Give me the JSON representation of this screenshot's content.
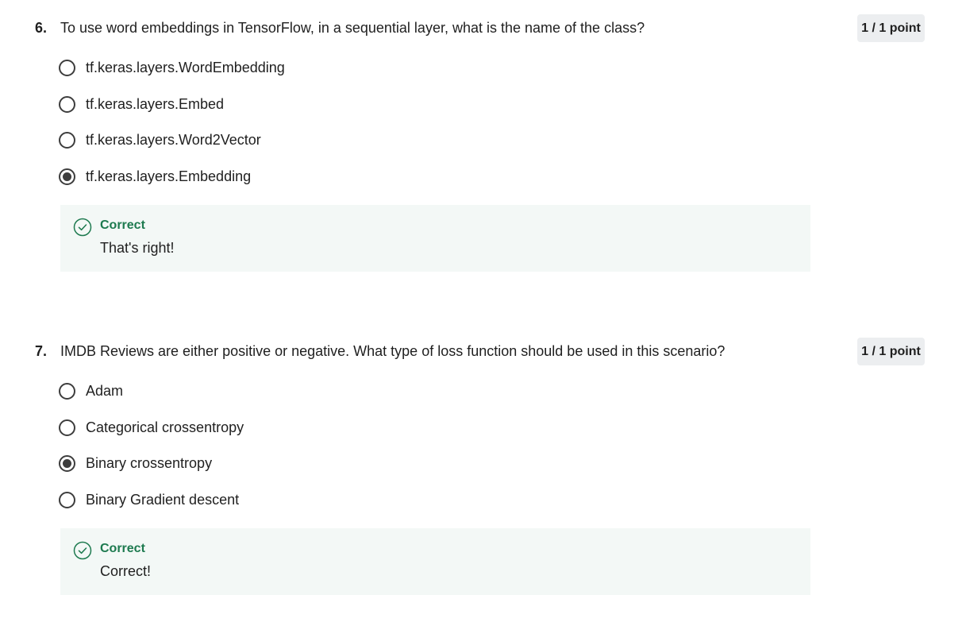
{
  "questions": [
    {
      "number": "6.",
      "text": "To use word embeddings in TensorFlow, in a sequential layer, what is the name of the class?",
      "points": "1 / 1 point",
      "options": [
        {
          "label": "tf.keras.layers.WordEmbedding",
          "selected": false
        },
        {
          "label": "tf.keras.layers.Embed",
          "selected": false
        },
        {
          "label": "tf.keras.layers.Word2Vector",
          "selected": false
        },
        {
          "label": "tf.keras.layers.Embedding",
          "selected": true
        }
      ],
      "feedback": {
        "title": "Correct",
        "text": "That's right!",
        "icon": "check-circle-icon",
        "color": "#1d7a4f"
      }
    },
    {
      "number": "7.",
      "text": "IMDB Reviews are either positive or negative. What type of loss function should be used in this scenario?",
      "points": "1 / 1 point",
      "options": [
        {
          "label": "Adam",
          "selected": false
        },
        {
          "label": "Categorical crossentropy",
          "selected": false
        },
        {
          "label": "Binary crossentropy",
          "selected": true
        },
        {
          "label": "Binary Gradient descent",
          "selected": false
        }
      ],
      "feedback": {
        "title": "Correct",
        "text": "Correct!",
        "icon": "check-circle-icon",
        "color": "#1d7a4f"
      }
    }
  ]
}
